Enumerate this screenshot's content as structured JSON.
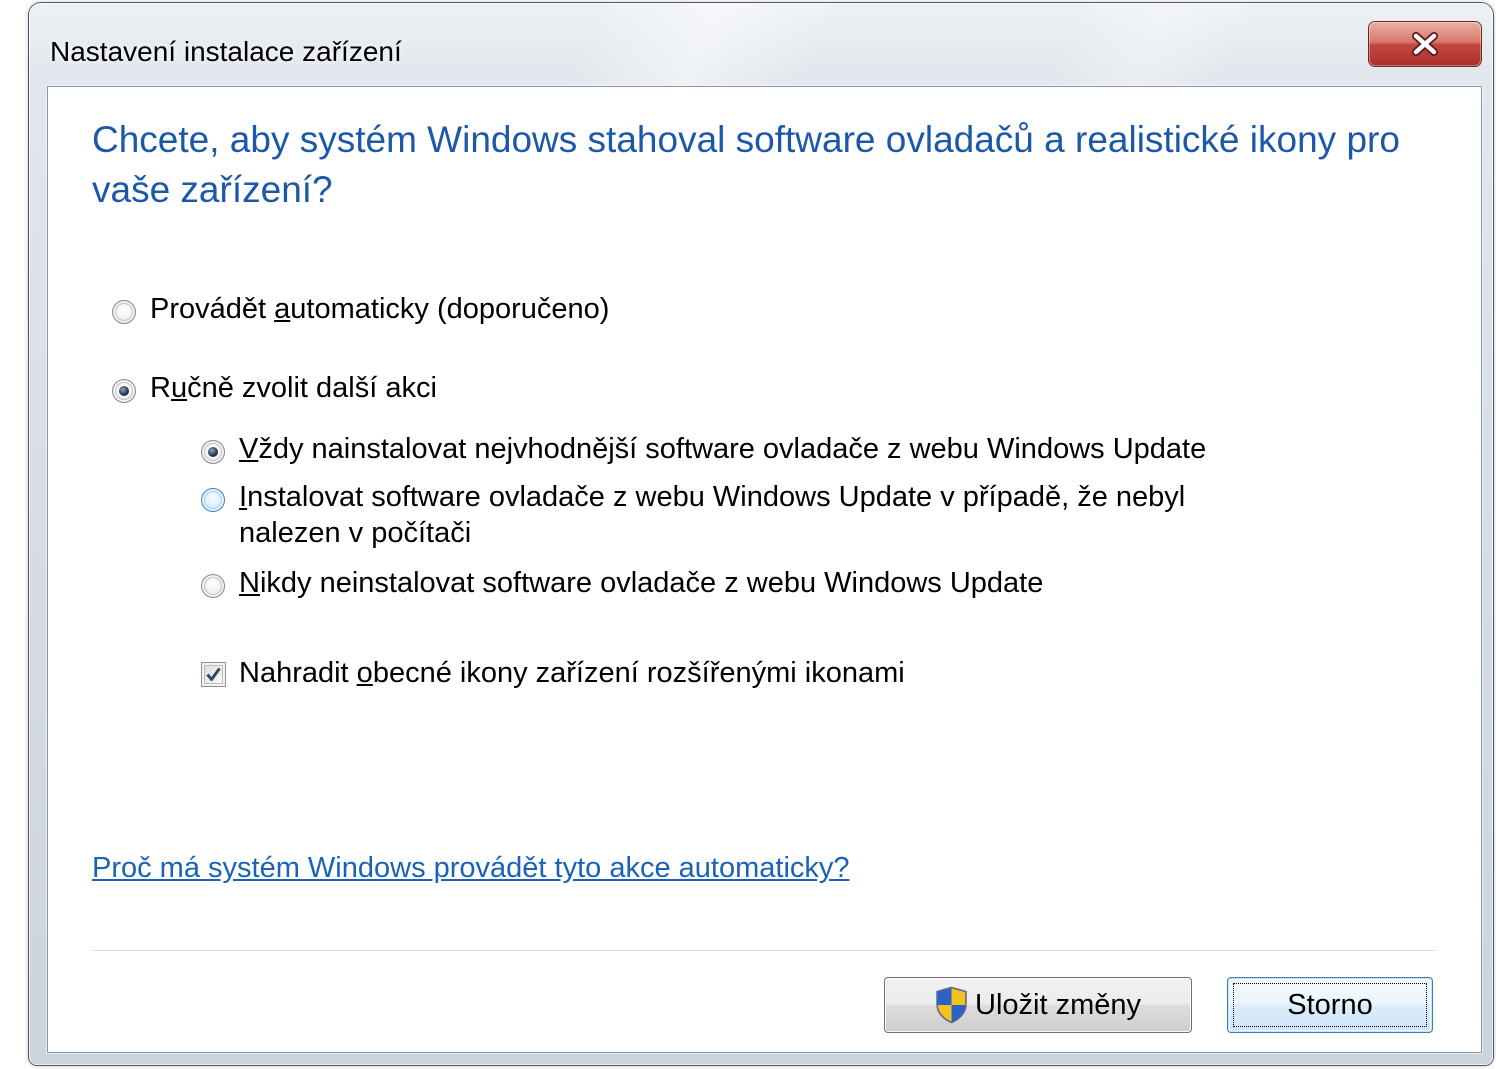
{
  "window": {
    "title": "Nastavení instalace zařízení",
    "close_icon": "close-icon"
  },
  "main": {
    "heading": "Chcete, aby systém Windows stahoval software ovladačů a realistické ikony pro vaše zařízení?",
    "options": [
      {
        "label": "Provádět automaticky (doporučeno)",
        "access_key": "a",
        "checked": false
      },
      {
        "label": "Ručně zvolit další akci",
        "access_key": "u",
        "checked": true
      }
    ],
    "sub_options": [
      {
        "label": "Vždy nainstalovat nejvhodnější software ovladače z webu Windows Update",
        "access_key": "V",
        "checked": true
      },
      {
        "label": "Instalovat software ovladače z webu Windows Update v případě, že nebyl nalezen v počítači",
        "access_key": "I",
        "checked": false
      },
      {
        "label": "Nikdy neinstalovat software ovladače z webu Windows Update",
        "access_key": "N",
        "checked": false
      }
    ],
    "replace_icons": {
      "label": "Nahradit obecné ikony zařízení rozšířenými ikonami",
      "access_key": "o",
      "checked": true
    },
    "help_link": "Proč má systém Windows provádět tyto akce automaticky?"
  },
  "footer": {
    "save_label": "Uložit změny",
    "save_icon": "uac-shield-icon",
    "cancel_label": "Storno"
  },
  "colors": {
    "heading": "#1c58a8",
    "link": "#1a62b6",
    "close_button": "#c2473f"
  }
}
